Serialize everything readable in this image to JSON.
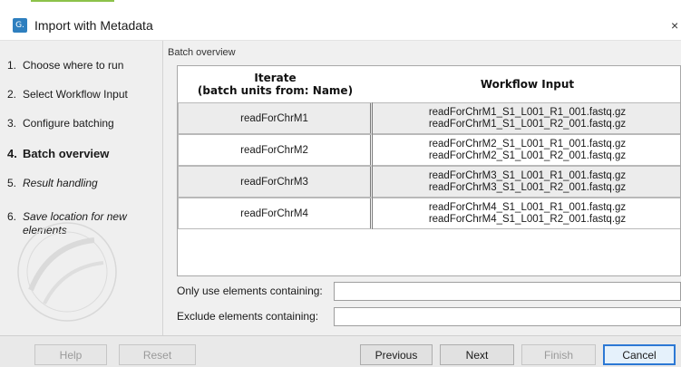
{
  "window": {
    "title": "Import with Metadata",
    "app_icon_glyph": "G.",
    "close_glyph": "×"
  },
  "steps": [
    {
      "num": "1.",
      "label": "Choose where to run"
    },
    {
      "num": "2.",
      "label": "Select Workflow Input"
    },
    {
      "num": "3.",
      "label": "Configure batching"
    },
    {
      "num": "4.",
      "label": "Batch overview"
    },
    {
      "num": "5.",
      "label": "Result handling"
    },
    {
      "num": "6.",
      "label": "Save location for new elements"
    }
  ],
  "main": {
    "section_title": "Batch overview",
    "table": {
      "col1_header_line1": "Iterate",
      "col1_header_line2": "(batch units from: Name)",
      "col2_header": "Workflow Input",
      "rows": [
        {
          "unit": "readForChrM1",
          "inputs": [
            "readForChrM1_S1_L001_R1_001.fastq.gz",
            "readForChrM1_S1_L001_R2_001.fastq.gz"
          ]
        },
        {
          "unit": "readForChrM2",
          "inputs": [
            "readForChrM2_S1_L001_R1_001.fastq.gz",
            "readForChrM2_S1_L001_R2_001.fastq.gz"
          ]
        },
        {
          "unit": "readForChrM3",
          "inputs": [
            "readForChrM3_S1_L001_R1_001.fastq.gz",
            "readForChrM3_S1_L001_R2_001.fastq.gz"
          ]
        },
        {
          "unit": "readForChrM4",
          "inputs": [
            "readForChrM4_S1_L001_R1_001.fastq.gz",
            "readForChrM4_S1_L001_R2_001.fastq.gz"
          ]
        }
      ]
    },
    "filters": {
      "only_use_label": "Only use elements containing:",
      "only_use_value": "",
      "exclude_label": "Exclude elements containing:",
      "exclude_value": ""
    }
  },
  "buttons": {
    "help": "Help",
    "reset": "Reset",
    "previous": "Previous",
    "next": "Next",
    "finish": "Finish",
    "cancel": "Cancel"
  },
  "colors": {
    "primary_button_border": "#2c78d4",
    "app_icon": "#2e7fbf",
    "top_accent": "#8cc24a"
  }
}
